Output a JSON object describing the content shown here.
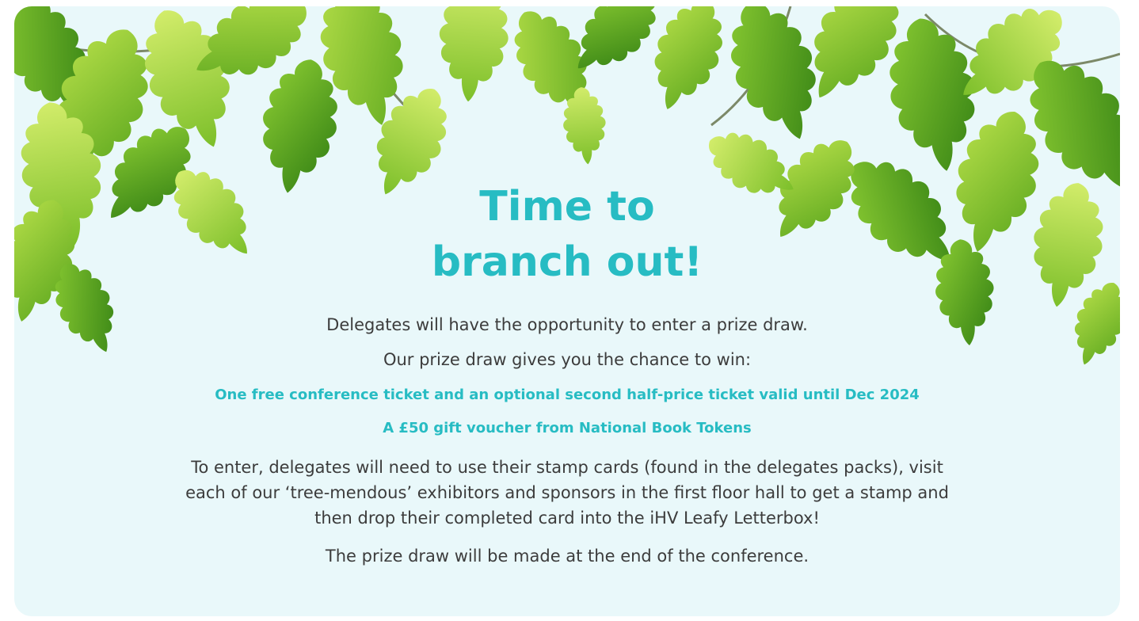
{
  "colors": {
    "accent": "#27bcc3",
    "background": "#e9f8fa",
    "body_text": "#3c3c3c",
    "leaf_light": "#9fd43a",
    "leaf_dark": "#3f8c17"
  },
  "banner": {
    "title_line1": "Time to",
    "title_line2": "branch out!",
    "intro": "Delegates will have the opportunity to enter a prize draw.",
    "chance": "Our prize draw gives you the chance to win:",
    "prizes": [
      "One free conference ticket and an optional second half-price ticket valid until Dec 2024",
      "A £50 gift voucher from National Book Tokens"
    ],
    "instructions": "To enter, delegates will need to use their stamp cards (found in the delegates packs), visit each of our ‘tree-mendous’ exhibitors and sponsors in the first floor hall to get a stamp and then drop their completed card into the iHV Leafy Letterbox!",
    "closing": "The prize draw will be made at the end of the conference."
  },
  "decoration": {
    "icon": "oak-leaf-canopy-icon"
  }
}
